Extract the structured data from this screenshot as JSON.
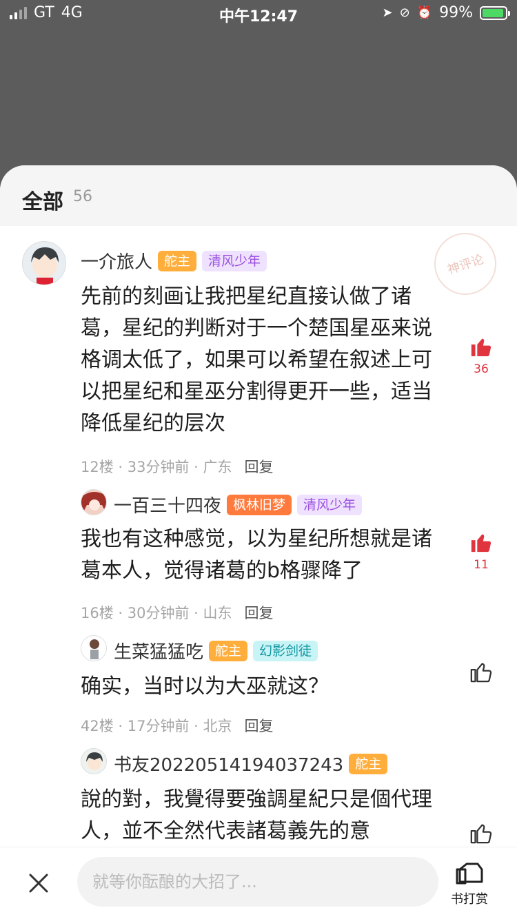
{
  "status": {
    "carrier": "GT",
    "network": "4G",
    "time": "中午12:47",
    "battery": "99%"
  },
  "header": {
    "tab_label": "全部",
    "count": "56"
  },
  "stamp_text": "神评论",
  "comments": [
    {
      "user": "一介旅人",
      "badges": [
        "舵主",
        "清风少年"
      ],
      "text": "先前的刻画让我把星纪直接认做了诸葛，星纪的判断对于一个楚国星巫来说格调太低了，如果可以希望在叙述上可以把星纪和星巫分割得更开一些，适当降低星纪的层次",
      "meta": "12楼 · 33分钟前 · 广东",
      "reply": "回复",
      "likes": "36"
    },
    {
      "user": "一百三十四夜",
      "badges": [
        "枫林旧梦",
        "清风少年"
      ],
      "text": "我也有这种感觉，以为星纪所想就是诸葛本人，觉得诸葛的b格骤降了",
      "meta": "16楼 · 30分钟前 · 山东",
      "reply": "回复",
      "likes": "11"
    },
    {
      "user": "生菜猛猛吃",
      "badges": [
        "舵主",
        "幻影剑徒"
      ],
      "text": "确实，当时以为大巫就这？",
      "meta": "42楼 · 17分钟前 · 北京",
      "reply": "回复",
      "likes": ""
    },
    {
      "user": "书友20220514194037243",
      "badges": [
        "舵主"
      ],
      "text": "說的對，我覺得要強調星紀只是個代理人，並不全然代表諸葛義先的意",
      "meta": "",
      "reply": "",
      "likes": ""
    }
  ],
  "bottom": {
    "placeholder": "就等你酝酿的大招了...",
    "tip_label": "书打赏"
  },
  "colors": {
    "accent": "#e0343e",
    "overlay": "#5c5c5c"
  }
}
